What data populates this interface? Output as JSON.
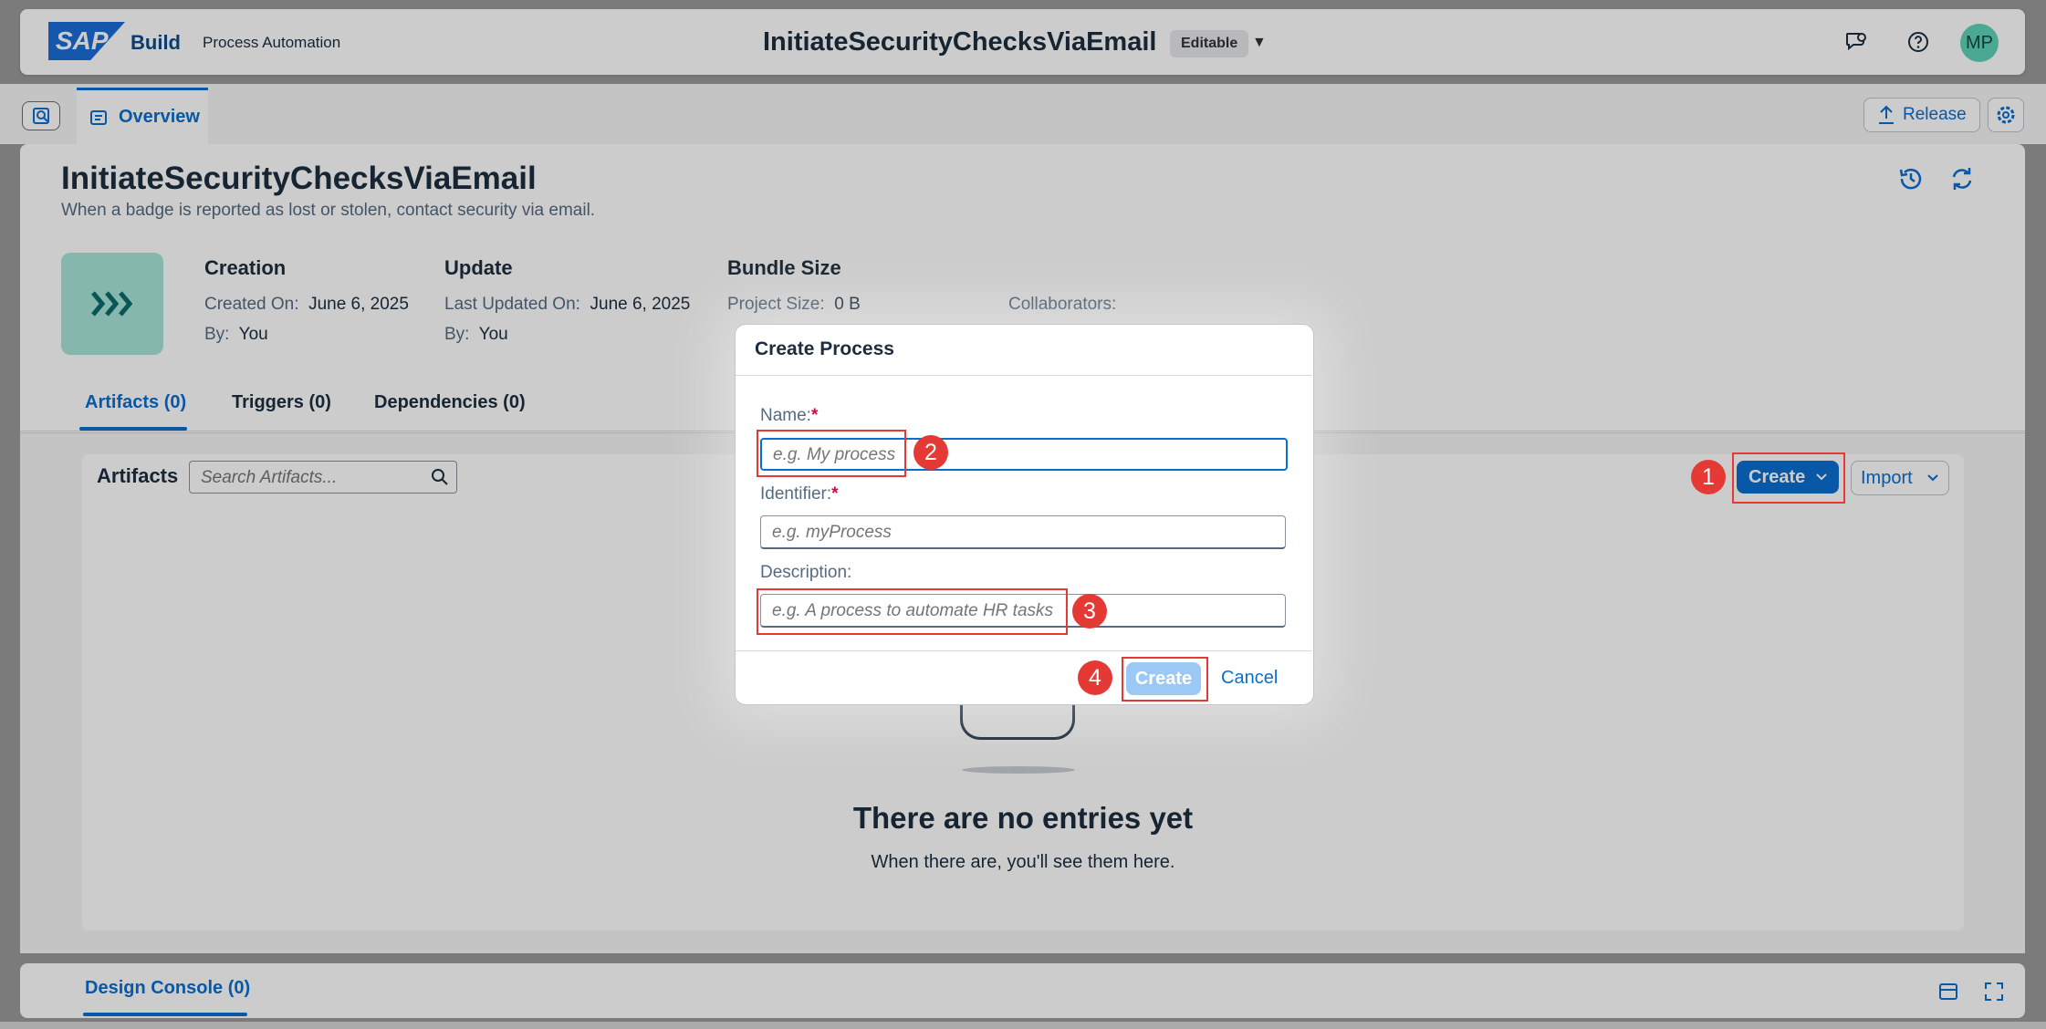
{
  "shellbar": {
    "logo_text": "SAP",
    "brand": "Build",
    "product": "Process Automation",
    "project_title": "InitiateSecurityChecksViaEmail",
    "editable_badge": "Editable",
    "avatar_initials": "MP"
  },
  "tabs": {
    "overview": "Overview",
    "release": "Release"
  },
  "project": {
    "title": "InitiateSecurityChecksViaEmail",
    "description": "When a badge is reported as lost or stolen, contact security via email.",
    "creation": {
      "heading": "Creation",
      "created_on_label": "Created On:",
      "created_on": "June 6, 2025",
      "by_label": "By:",
      "by": "You"
    },
    "update": {
      "heading": "Update",
      "updated_on_label": "Last Updated On:",
      "updated_on": "June 6, 2025",
      "by_label": "By:",
      "by": "You"
    },
    "bundle": {
      "heading": "Bundle Size",
      "project_size_label": "Project Size:",
      "project_size": "0 B"
    },
    "collaborators_label": "Collaborators:"
  },
  "section_tabs": [
    "Artifacts (0)",
    "Triggers (0)",
    "Dependencies (0)"
  ],
  "artifacts": {
    "label": "Artifacts",
    "search_placeholder": "Search Artifacts...",
    "create": "Create",
    "import": "Import",
    "empty_title": "There are no entries yet",
    "empty_subtitle": "When there are, you'll see them here."
  },
  "console": {
    "tab": "Design Console (0)"
  },
  "dialog": {
    "title": "Create Process",
    "name_label": "Name:",
    "name_placeholder": "e.g. My process",
    "identifier_label": "Identifier:",
    "identifier_placeholder": "e.g. myProcess",
    "description_label": "Description:",
    "description_placeholder": "e.g. A process to automate HR tasks",
    "required_mark": "*",
    "create": "Create",
    "cancel": "Cancel"
  },
  "markers": [
    "1",
    "2",
    "3",
    "4"
  ],
  "colors": {
    "accent": "#0a6ed1",
    "annotation": "#e53935",
    "project_icon_bg": "#a7e5d9"
  }
}
